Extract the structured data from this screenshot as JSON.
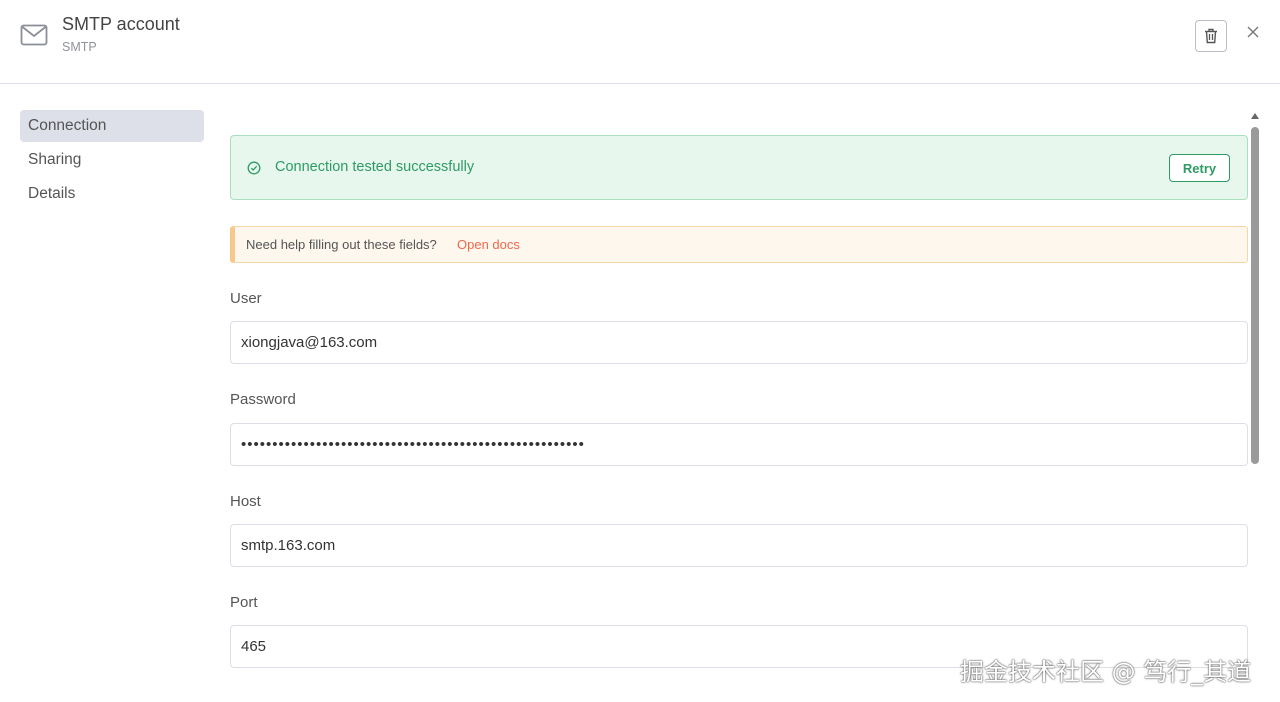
{
  "header": {
    "title": "SMTP account",
    "subtitle": "SMTP",
    "icons": {
      "mail": "mail-icon",
      "delete": "trash-icon",
      "close": "close-icon"
    }
  },
  "sidebar": {
    "items": [
      {
        "label": "Connection",
        "active": true
      },
      {
        "label": "Sharing",
        "active": false
      },
      {
        "label": "Details",
        "active": false
      }
    ]
  },
  "status": {
    "message": "Connection tested successfully",
    "retry_label": "Retry",
    "color": "#2f9a64"
  },
  "help": {
    "text": "Need help filling out these fields?",
    "link": "Open docs",
    "link_color": "#f0684a"
  },
  "fields": {
    "user": {
      "label": "User",
      "value": "xiongjava@163.com"
    },
    "password": {
      "label": "Password",
      "value": "•••••••••••••••••••••••••••••••••••••••••••••••••••••••"
    },
    "host": {
      "label": "Host",
      "value": "smtp.163.com"
    },
    "port": {
      "label": "Port",
      "value": "465"
    }
  },
  "watermark": "掘金技术社区 @ 笃行_其道"
}
